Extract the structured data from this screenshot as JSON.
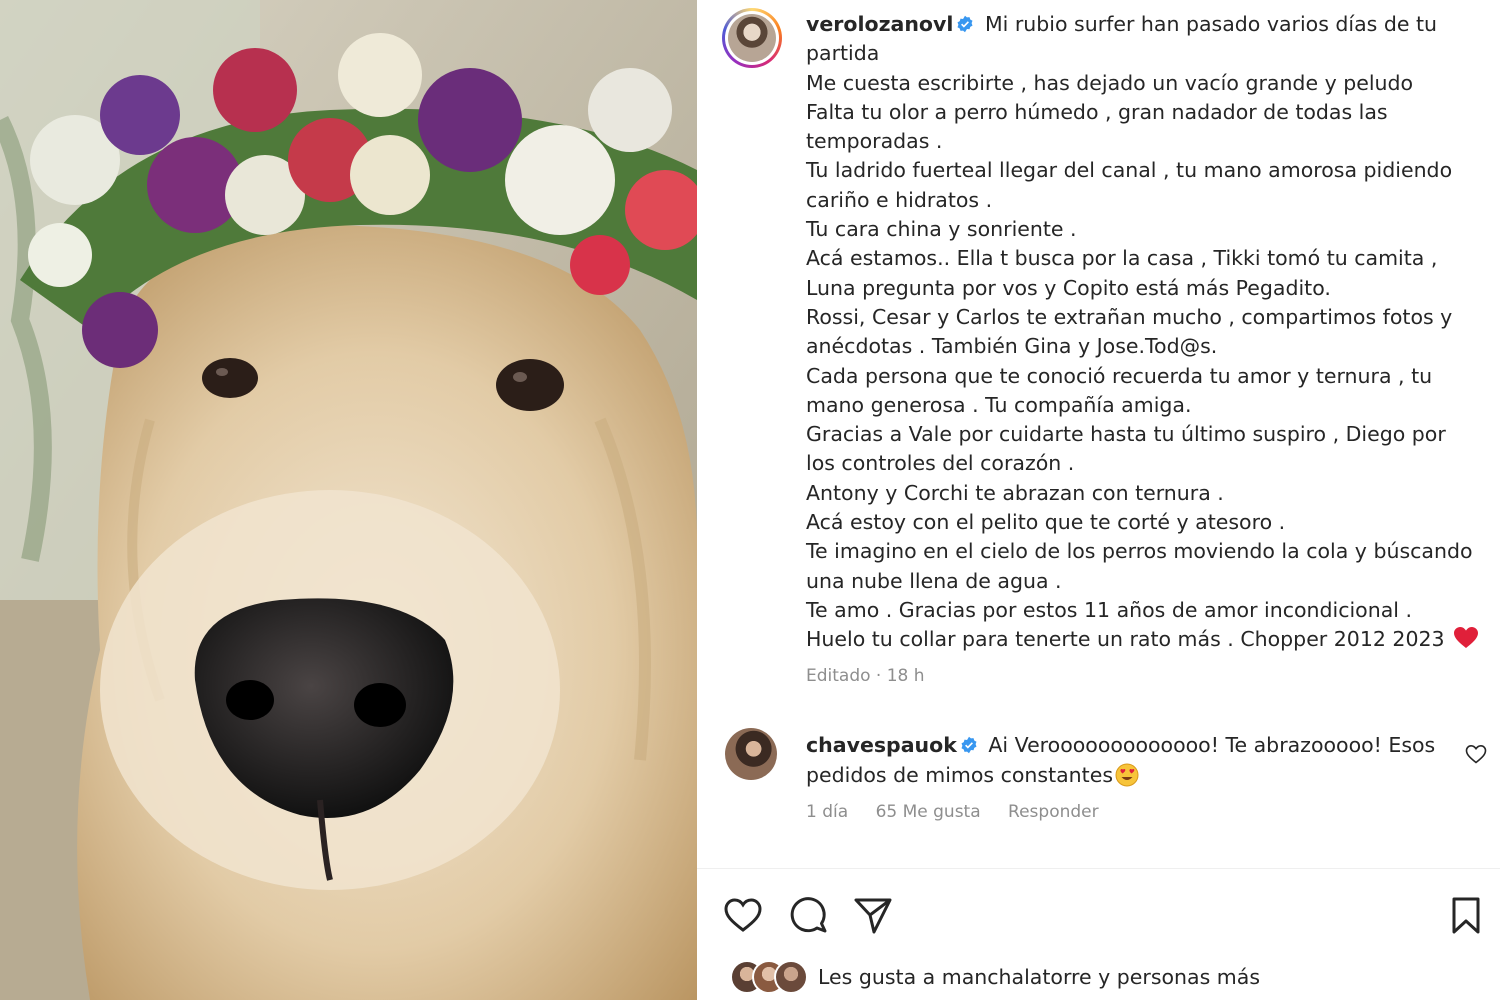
{
  "post": {
    "username": "verolozanovl",
    "caption_lines": [
      "Mi rubio surfer han pasado varios días de tu",
      "partida",
      "Me cuesta escribirte , has dejado un vacío grande y peludo",
      "Falta tu olor a perro húmedo , gran nadador de todas las",
      "temporadas .",
      "Tu ladrido fuerteal llegar del canal , tu mano amorosa pidiendo",
      "cariño e hidratos .",
      "Tu cara china y sonriente .",
      "Acá estamos.. Ella t busca por la casa , Tikki tomó tu camita ,",
      "Luna pregunta por vos y Copito está más Pegadito.",
      "Rossi, Cesar y Carlos te extrañan mucho , compartimos fotos y",
      "anécdotas . También Gina y Jose.Tod@s.",
      "Cada persona que te conoció recuerda tu amor y ternura , tu",
      "mano generosa . Tu compañía amiga.",
      "Gracias a Vale por cuidarte hasta tu último suspiro , Diego por",
      "los controles del corazón .",
      "Antony y Corchi te abrazan con ternura .",
      "Acá estoy con el pelito que te corté y atesoro .",
      "Te imagino en el cielo de los perros moviendo la cola y búscando",
      "una nube llena de agua .",
      "Te amo . Gracias por estos 11 años de amor incondicional .",
      "Huelo tu collar para tenerte un rato más . Chopper 2012 2023"
    ],
    "meta": "Editado · 18 h"
  },
  "comment": {
    "username": "chavespauok",
    "text_line1": "Ai Verooooooooooooo! Te abrazooooo! Esos",
    "text_line2": "pedidos de mimos constantes",
    "time": "1 día",
    "likes": "65 Me gusta",
    "reply": "Responder"
  },
  "likes_text": "Les gusta a manchalatorre y personas más",
  "icons": {
    "verified": "verified-badge-icon",
    "heart": "heart-icon",
    "comment": "comment-icon",
    "share": "share-icon",
    "save": "bookmark-icon"
  },
  "colors": {
    "verified": "#3897f0",
    "heart_emoji": "#e0203a",
    "meta": "#8e8e8e"
  }
}
